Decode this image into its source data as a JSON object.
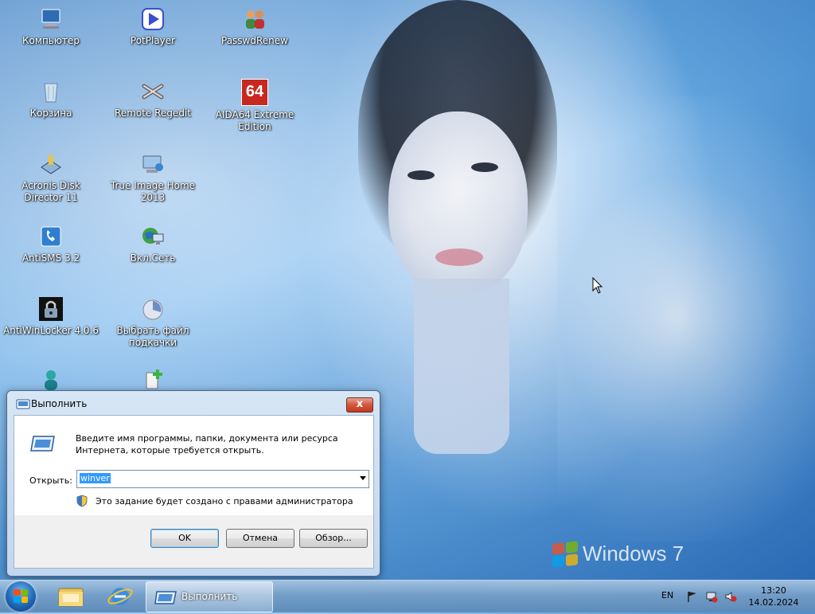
{
  "desktop": {
    "icons": [
      {
        "label": "Компьютер",
        "icon": "computer-icon"
      },
      {
        "label": "PotPlayer",
        "icon": "potplayer-icon"
      },
      {
        "label": "PasswdRenew",
        "icon": "users-icon"
      },
      {
        "label": "Корзина",
        "icon": "recycle-bin-icon"
      },
      {
        "label": "Remote Regedit",
        "icon": "regedit-icon"
      },
      {
        "label": "AIDA64 Extreme Edition",
        "icon": "aida64-icon",
        "badge": "64"
      },
      {
        "label": "Acronis Disk Director 11",
        "icon": "acronis-icon"
      },
      {
        "label": "True Image Home 2013",
        "icon": "true-image-icon"
      },
      {
        "label": "AntiSMS 3.2",
        "icon": "phone-icon"
      },
      {
        "label": "Вкл.Сеть",
        "icon": "network-globe-icon"
      },
      {
        "label": "AntiWinLocker 4.0.6",
        "icon": "lock-icon"
      },
      {
        "label": "Выбрать файл подкачки",
        "icon": "pagefile-icon"
      },
      {
        "label": "",
        "icon": "user-icon"
      },
      {
        "label": "",
        "icon": "add-file-icon"
      }
    ],
    "watermark": "Windows 7"
  },
  "run_dialog": {
    "title": "Выполнить",
    "description": "Введите имя программы, папки, документа или ресурса Интернета, которые требуется открыть.",
    "open_label": "Открыть:",
    "input_value": "winver",
    "admin_note": "Это задание будет создано с правами администратора",
    "buttons": {
      "ok": "OK",
      "cancel": "Отмена",
      "browse": "Обзор..."
    },
    "close_symbol": "x"
  },
  "taskbar": {
    "active_window": "Выполнить",
    "language": "EN",
    "time": "13:20",
    "date": "14.02.2024"
  },
  "colors": {
    "accent": "#1f68b5",
    "selection": "#3399ff",
    "close": "#c23a1f"
  }
}
